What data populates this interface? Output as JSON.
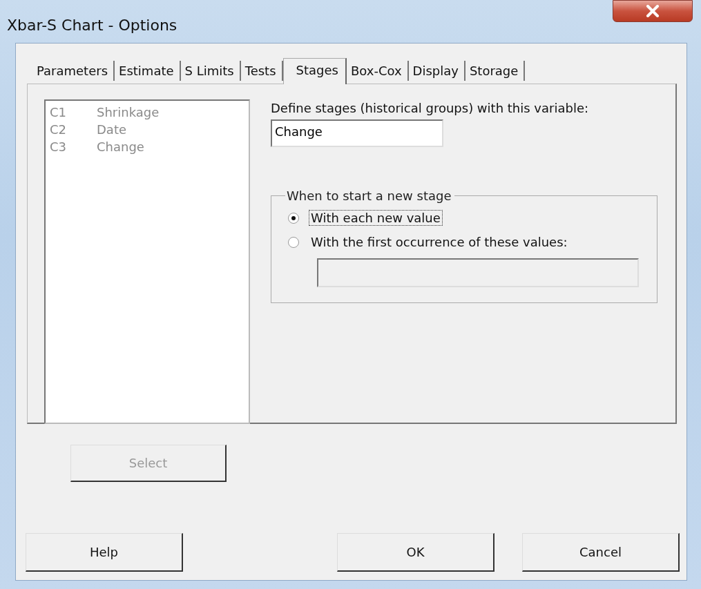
{
  "window": {
    "title": "Xbar-S Chart - Options"
  },
  "tabs": [
    {
      "label": "Parameters",
      "selected": false
    },
    {
      "label": "Estimate",
      "selected": false
    },
    {
      "label": "S Limits",
      "selected": false
    },
    {
      "label": "Tests",
      "selected": false
    },
    {
      "label": "Stages",
      "selected": true
    },
    {
      "label": "Box-Cox",
      "selected": false
    },
    {
      "label": "Display",
      "selected": false
    },
    {
      "label": "Storage",
      "selected": false
    }
  ],
  "variable_list": {
    "disabled": true,
    "items": [
      {
        "column": "C1",
        "name": "Shrinkage"
      },
      {
        "column": "C2",
        "name": "Date"
      },
      {
        "column": "C3",
        "name": "Change"
      }
    ]
  },
  "select_button": {
    "label": "Select",
    "disabled": true
  },
  "stages_variable": {
    "label": "Define stages (historical groups) with this variable:",
    "value": "Change"
  },
  "new_stage_group": {
    "title": "When to start a new stage",
    "options": [
      {
        "label": "With each new value",
        "selected": true
      },
      {
        "label": "With the first occurrence of these values:",
        "selected": false
      }
    ],
    "values_field": {
      "disabled": true
    }
  },
  "buttons": [
    {
      "label": "Help"
    },
    {
      "label": "OK"
    },
    {
      "label": "Cancel"
    }
  ]
}
